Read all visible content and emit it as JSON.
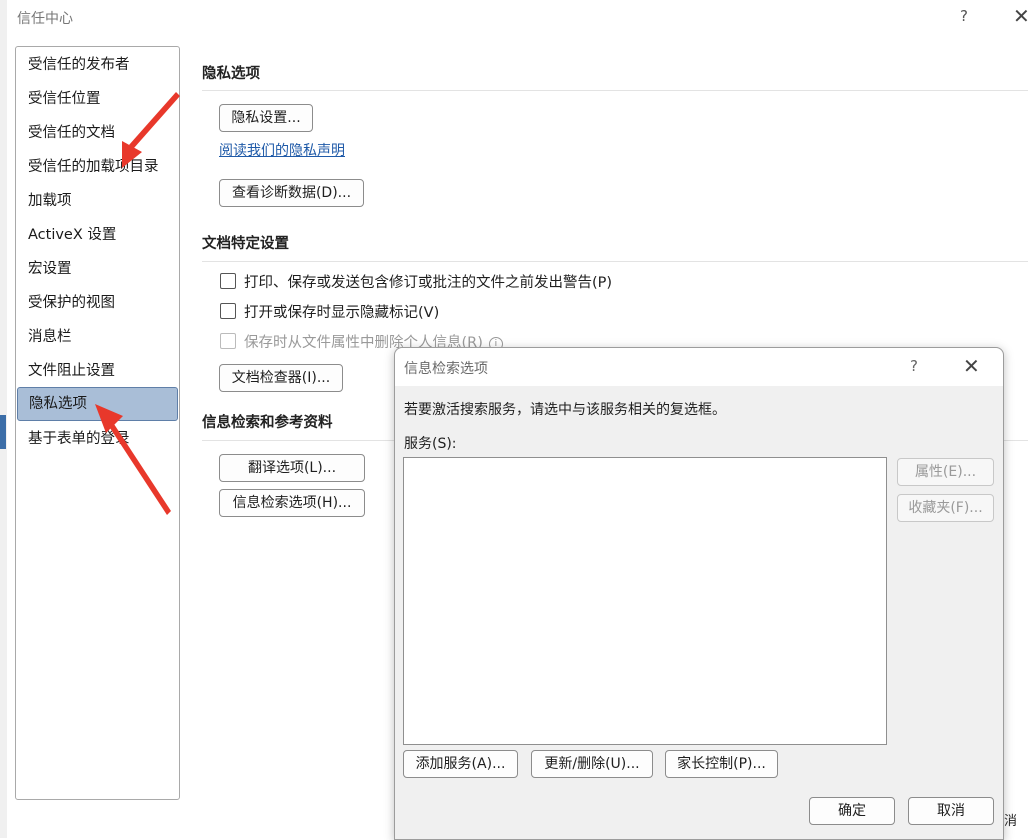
{
  "window": {
    "title": "信任中心",
    "help_glyph": "?",
    "close_glyph": "✕"
  },
  "nav": {
    "items": [
      {
        "label": "受信任的发布者"
      },
      {
        "label": "受信任位置"
      },
      {
        "label": "受信任的文档"
      },
      {
        "label": "受信任的加载项目录"
      },
      {
        "label": "加载项"
      },
      {
        "label": "ActiveX 设置"
      },
      {
        "label": "宏设置"
      },
      {
        "label": "受保护的视图"
      },
      {
        "label": "消息栏"
      },
      {
        "label": "文件阻止设置"
      },
      {
        "label": "隐私选项"
      },
      {
        "label": "基于表单的登录"
      }
    ],
    "selected_index": 10
  },
  "privacy": {
    "section_title": "隐私选项",
    "privacy_settings_button": "隐私设置...",
    "privacy_statement_link": "阅读我们的隐私声明",
    "diagnostic_button": "查看诊断数据(D)..."
  },
  "document": {
    "section_title": "文档特定设置",
    "check_warn": "打印、保存或发送包含修订或批注的文件之前发出警告(P)",
    "check_hidden": "打开或保存时显示隐藏标记(V)",
    "check_remove_info": "保存时从文件属性中删除个人信息(R)",
    "info_icon_glyph": "i",
    "inspector_button": "文档检查器(I)..."
  },
  "research": {
    "section_title": "信息检索和参考资料",
    "translate_button": "翻译选项(L)...",
    "research_button": "信息检索选项(H)..."
  },
  "dialog": {
    "title": "信息检索选项",
    "help_glyph": "?",
    "close_glyph": "✕",
    "description": "若要激活搜索服务，请选中与该服务相关的复选框。",
    "services_label": "服务(S):",
    "properties_button": "属性(E)...",
    "favorites_button": "收藏夹(F)...",
    "add_service_button": "添加服务(A)...",
    "update_remove_button": "更新/删除(U)...",
    "parental_button": "家长控制(P)...",
    "ok_button": "确定",
    "cancel_button": "取消",
    "partial_cancel_text": "消"
  },
  "colors": {
    "selection_bg": "#a9bed7",
    "link": "#1f5aa8",
    "annotation_arrow": "#e8382b"
  }
}
